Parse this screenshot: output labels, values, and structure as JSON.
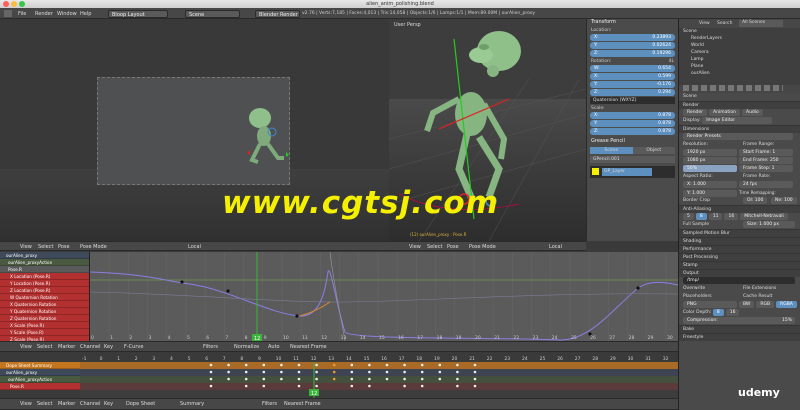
{
  "window": {
    "title": "alien_anim_polishing.blend"
  },
  "topbar": {
    "menus": [
      "File",
      "Render",
      "Window",
      "Help"
    ],
    "layout": "Bloop Layout",
    "scene": "Scene",
    "engine": "Blender Render",
    "info": "v2.76 | Verts:7,185 | Faces:4,013 | Tris:14,058 | Objects:1/6 | Lamps:1/1 | Mem:89.00M | ourAlien_proxy"
  },
  "viewport": {
    "label": "User Persp",
    "obj_label": "(12) ourAlien_proxy : Pose.R"
  },
  "header_views": [
    "View",
    "Select",
    "Pose",
    "Pose Mode",
    "Local"
  ],
  "npanel": {
    "transform_title": "Transform",
    "location_label": "Location:",
    "location": [
      {
        "k": "X:",
        "v": "0.23893"
      },
      {
        "k": "Y:",
        "v": "0.02624"
      },
      {
        "k": "Z:",
        "v": "0.19296"
      }
    ],
    "rotation_label": "Rotation:",
    "rotation_extra": "4L",
    "rotation": [
      {
        "k": "W:",
        "v": "0.654"
      },
      {
        "k": "X:",
        "v": "0.599"
      },
      {
        "k": "Y:",
        "v": "-0.176"
      },
      {
        "k": "Z:",
        "v": "0.294"
      }
    ],
    "rotation_mode": "Quaternion (WXYZ)",
    "scale_label": "Scale:",
    "scale": [
      {
        "k": "X:",
        "v": "0.878"
      },
      {
        "k": "Y:",
        "v": "0.878"
      },
      {
        "k": "Z:",
        "v": "0.878"
      }
    ],
    "grease_pencil": "Grease Pencil",
    "gp_tabs": [
      "Scene",
      "Object"
    ],
    "gp_name": "GPencil.001",
    "gp_layer": "GP_Layer"
  },
  "outliner": {
    "menus": [
      "View",
      "Search",
      "All Scenes"
    ],
    "items": [
      "Scene",
      "RenderLayers",
      "World",
      "Camera",
      "Lamp",
      "Plane",
      "ourAlien"
    ]
  },
  "properties": {
    "scene": "Scene",
    "render_title": "Render",
    "render_buttons": [
      "Render",
      "Animation",
      "Audio"
    ],
    "display_label": "Display:",
    "display_value": "Image Editor",
    "dimensions": "Dimensions",
    "presets": "Render Presets",
    "resolution_label": "Resolution:",
    "res_x": "1920 px",
    "res_y": "1080 px",
    "res_pct": "50%",
    "frame_range": "Frame Range:",
    "start_frame": "Start Frame: 1",
    "end_frame": "End Frame: 250",
    "frame_step": "Frame Step: 1",
    "aspect": "Aspect Ratio:",
    "aspect_x": "X: 1.000",
    "aspect_y": "Y: 1.000",
    "frame_rate": "Frame Rate:",
    "fps": "24 fps",
    "time_remap": "Time Remapping:",
    "old": "Ol: 100",
    "new": "Ne: 100",
    "border": "Border",
    "crop": "Crop",
    "aa": "Anti-Aliasing",
    "aa_samples": [
      "5",
      "8",
      "11",
      "16"
    ],
    "aa_filter": "Mitchell-Netravali",
    "full_sample": "Full Sample",
    "size": "Size: 1.000 px",
    "sections": [
      "Sampled Motion Blur",
      "Shading",
      "Performance",
      "Post Processing",
      "Stamp",
      "Output"
    ],
    "output_path": "/tmp/",
    "overwrite": "Overwrite",
    "file_ext": "File Extensions",
    "placeholders": "Placeholders",
    "cache": "Cache Result",
    "format": "PNG",
    "bw": "BW",
    "rgb": "RGB",
    "rgba": "RGBA",
    "color_depth": "Color Depth:",
    "depth8": "8",
    "depth16": "16",
    "compression": "Compression:",
    "compression_v": "15%",
    "bake": "Bake",
    "freestyle": "Freestyle"
  },
  "graph": {
    "channels": [
      "ourAlien_proxy",
      "ourAlien_proxyAction",
      "Pose.R",
      "X Location (Pose.R)",
      "Y Location (Pose.R)",
      "Z Location (Pose.R)",
      "W Quaternion Rotation",
      "X Quaternion Rotation",
      "Y Quaternion Rotation",
      "Z Quaternion Rotation",
      "X Scale (Pose.R)",
      "Y Scale (Pose.R)",
      "Z Scale (Pose.R)"
    ],
    "frames": [
      "0",
      "1",
      "2",
      "3",
      "4",
      "5",
      "6",
      "7",
      "8",
      "9",
      "10",
      "11",
      "12",
      "13",
      "14",
      "15",
      "16",
      "17",
      "18",
      "19",
      "20",
      "21",
      "22",
      "23",
      "24",
      "25",
      "26",
      "27",
      "28",
      "29",
      "30"
    ],
    "current_frame": "12",
    "header": [
      "View",
      "Select",
      "Marker",
      "Channel",
      "Key",
      "F-Curve",
      "Filters",
      "Normalize",
      "Auto",
      "Nearest Frame"
    ]
  },
  "dopesheet": {
    "channels": [
      "Dope Sheet Summary",
      "ourAlien_proxy",
      "ourAlien_proxyAction",
      "Pose.R"
    ],
    "frames": [
      "-1",
      "0",
      "1",
      "2",
      "3",
      "4",
      "5",
      "6",
      "7",
      "8",
      "9",
      "10",
      "11",
      "12",
      "13",
      "14",
      "15",
      "16",
      "17",
      "18",
      "19",
      "20",
      "21",
      "22",
      "23",
      "24",
      "25",
      "26",
      "27",
      "28",
      "29",
      "30",
      "31",
      "32"
    ],
    "current_frame": "12",
    "header": [
      "View",
      "Select",
      "Marker",
      "Channel",
      "Key",
      "Dope Sheet",
      "Summary",
      "Filters",
      "Nearest Frame"
    ]
  },
  "watermark": "www.cgtsj.com",
  "brand": "udemy",
  "colors": {
    "accent": "#5d8fbf",
    "playhead": "#3ab53a",
    "curve": "#8a7fe6",
    "watermark": "#f4f000",
    "channel_red": "#b23030"
  }
}
